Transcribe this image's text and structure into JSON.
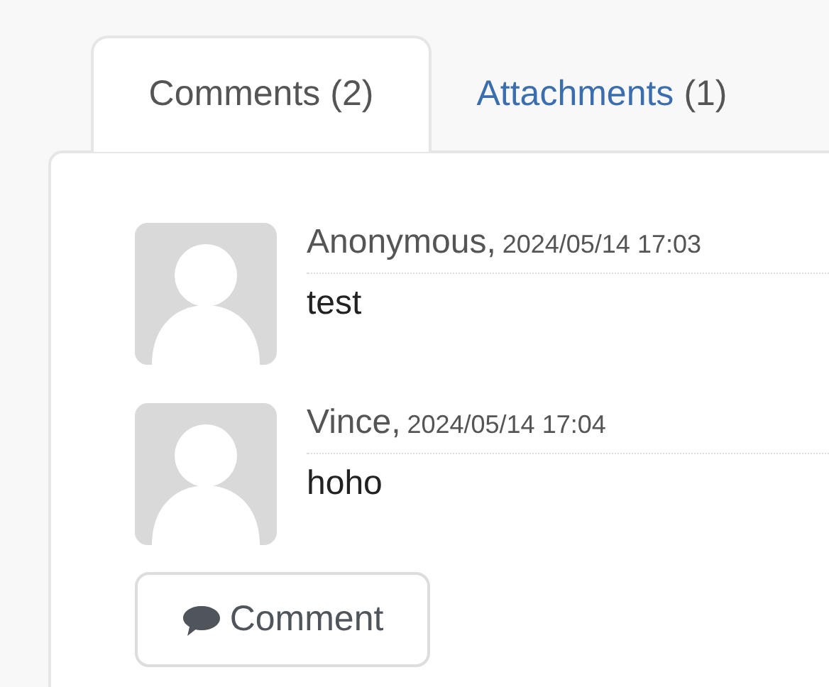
{
  "tabs": [
    {
      "label": "Comments",
      "count": "(2)",
      "selected": true
    },
    {
      "label": "Attachments",
      "count": "(1)",
      "selected": false
    }
  ],
  "comments": [
    {
      "author": "Anonymous,",
      "time": "2024/05/14 17:03",
      "text": "test"
    },
    {
      "author": "Vince,",
      "time": "2024/05/14 17:04",
      "text": "hoho"
    }
  ],
  "comment_button": "Comment"
}
